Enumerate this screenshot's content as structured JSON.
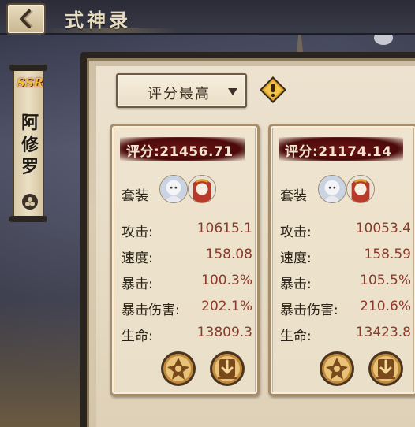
{
  "header": {
    "title": "式神录"
  },
  "shikigami": {
    "rarity": "SSR",
    "name": "阿修罗"
  },
  "toolbar": {
    "sort_label": "评分最高"
  },
  "cards": [
    {
      "score": "评分:21456.71",
      "set_label": "套装",
      "stats": [
        {
          "label": "攻击:",
          "value": "10615.1"
        },
        {
          "label": "速度:",
          "value": "158.08"
        },
        {
          "label": "暴击:",
          "value": "100.3%"
        },
        {
          "label": "暴击伤害:",
          "value": "202.1%"
        },
        {
          "label": "生命:",
          "value": "13809.3"
        }
      ]
    },
    {
      "score": "评分:21174.14",
      "set_label": "套装",
      "stats": [
        {
          "label": "攻击:",
          "value": "10053.4"
        },
        {
          "label": "速度:",
          "value": "158.59"
        },
        {
          "label": "暴击:",
          "value": "105.5%"
        },
        {
          "label": "暴击伤害:",
          "value": "210.6%"
        },
        {
          "label": "生命:",
          "value": "13423.8"
        }
      ]
    }
  ],
  "colors": {
    "accent_red": "#8a3a2a",
    "score_banner": "#5e1010",
    "panel_bg": "#ece2cf",
    "rarity_gold": "#f4c235"
  },
  "icons": {
    "back": "back-arrow-icon",
    "hint": "exclamation-diamond-icon",
    "favorite": "shuriken-swap-icon",
    "equip": "download-arrow-icon"
  }
}
